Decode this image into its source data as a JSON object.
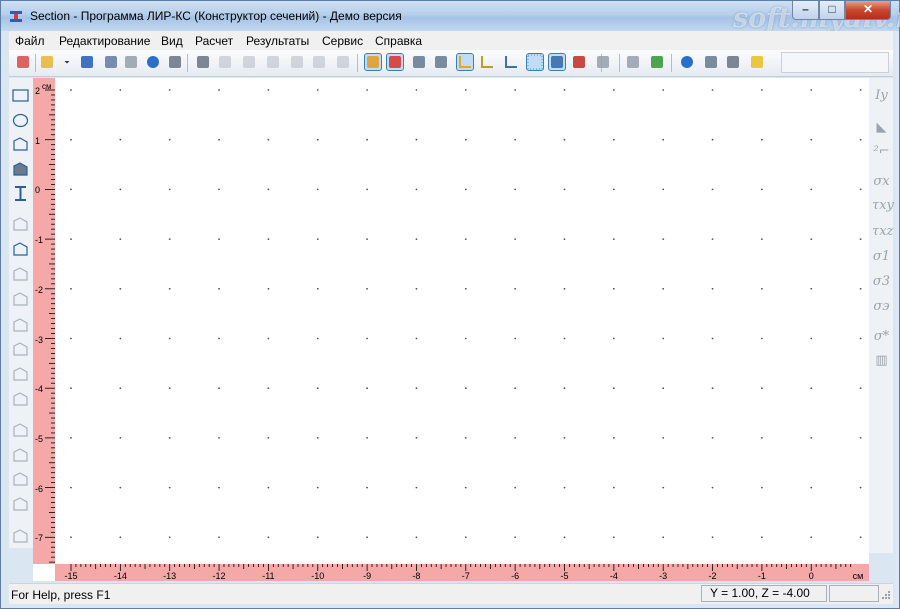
{
  "window": {
    "title": "Section - Программа ЛИР-КС (Конструктор сечений) - Демо версия",
    "watermark": "soft.mydiv.net",
    "controls": {
      "minimize": "–",
      "maximize": "□",
      "close": "✕"
    }
  },
  "menu": [
    {
      "label": "Файл"
    },
    {
      "label": "Редактирование"
    },
    {
      "label": "Вид"
    },
    {
      "label": "Расчет"
    },
    {
      "label": "Результаты"
    },
    {
      "label": "Сервис"
    },
    {
      "label": "Справка"
    }
  ],
  "toolbar": {
    "buttons": [
      {
        "icon": "new-document-icon",
        "color": "#d9534f"
      },
      {
        "icon": "open-folder-icon",
        "color": "#e9b73e"
      },
      {
        "icon": "dropdown-arrow-icon",
        "color": "#333333"
      },
      {
        "icon": "save-icon",
        "color": "#2f64b8"
      },
      {
        "icon": "save-as-icon",
        "color": "#6d7fa8"
      },
      {
        "icon": "import-icon",
        "color": "#9aa3ad"
      },
      {
        "icon": "info-icon",
        "color": "#2b6ec9"
      },
      {
        "icon": "print-icon",
        "color": "#707a86"
      },
      {
        "icon": "print-preview-icon",
        "color": "#707a86"
      },
      {
        "icon": "undo-icon",
        "color": "#b9c0c8"
      },
      {
        "icon": "redo-icon",
        "color": "#b9c0c8"
      },
      {
        "icon": "cut-icon",
        "color": "#b9c0c8"
      },
      {
        "icon": "copy-icon",
        "color": "#b9c0c8"
      },
      {
        "icon": "paste-icon",
        "color": "#b9c0c8"
      },
      {
        "icon": "delete-icon",
        "color": "#b9c0c8"
      },
      {
        "icon": "section-fill-icon",
        "color": "#e0a030",
        "active": true
      },
      {
        "icon": "color-fill-icon",
        "color": "#d93a3a",
        "active": true
      },
      {
        "icon": "zoom-icon",
        "color": "#6d7f95"
      },
      {
        "icon": "zoom-fit-icon",
        "color": "#6d7f95"
      },
      {
        "icon": "axes-box-icon",
        "color": "#e8a628",
        "active": true
      },
      {
        "icon": "axes-icon",
        "color": "#c29b2e"
      },
      {
        "icon": "axes-arrows-icon",
        "color": "#3f6fb0"
      },
      {
        "icon": "grid-icon",
        "color": "#4a90d9",
        "active": true
      },
      {
        "icon": "select-pointer-icon",
        "color": "#3a6ea8",
        "active": true
      },
      {
        "icon": "move-tool-icon",
        "color": "#c0392b"
      },
      {
        "icon": "layer-icon",
        "color": "#9aa3ad"
      },
      {
        "icon": "binoculars-icon",
        "color": "#9aa3ad"
      },
      {
        "icon": "flip-icon",
        "color": "#3c9a3c"
      },
      {
        "icon": "help-icon",
        "color": "#2b6ec9"
      },
      {
        "icon": "context-help-icon",
        "color": "#6d7f95"
      },
      {
        "icon": "about-icon",
        "color": "#707a86"
      },
      {
        "icon": "question-icon",
        "color": "#e8c22a"
      }
    ]
  },
  "left_tools": [
    {
      "icon": "rectangle-tool-icon",
      "enabled": true
    },
    {
      "icon": "ellipse-tool-icon",
      "enabled": true
    },
    {
      "icon": "polygon-tool-icon",
      "enabled": true
    },
    {
      "icon": "pin-tool-icon",
      "enabled": true
    },
    {
      "icon": "i-beam-tool-icon",
      "enabled": true
    },
    {
      "icon": "angle-profile-icon",
      "enabled": false
    },
    {
      "icon": "axes-origin-icon",
      "enabled": true
    },
    {
      "icon": "mirror-icon",
      "enabled": false
    },
    {
      "icon": "rotate-icon",
      "enabled": false
    },
    {
      "icon": "points-icon",
      "enabled": false
    },
    {
      "icon": "select-area-icon",
      "enabled": false
    },
    {
      "icon": "line-tool-icon",
      "enabled": false
    },
    {
      "icon": "dimension-icon",
      "enabled": false
    },
    {
      "icon": "copy-shape-icon",
      "enabled": false
    },
    {
      "icon": "array-icon",
      "enabled": false
    },
    {
      "icon": "union-icon",
      "enabled": false
    },
    {
      "icon": "subtract-icon",
      "enabled": false
    },
    {
      "icon": "group-icon",
      "enabled": false
    }
  ],
  "right_tools": [
    {
      "icon": "inertia-icon",
      "label": "Iy"
    },
    {
      "icon": "section-props-icon",
      "label": "◣"
    },
    {
      "icon": "section-stats-icon",
      "label": "²⌐"
    },
    {
      "icon": "sigma-x-icon",
      "label": "σx"
    },
    {
      "icon": "tau-xy-icon",
      "label": "τxy"
    },
    {
      "icon": "tau-xz-icon",
      "label": "τxz"
    },
    {
      "icon": "sigma-1-icon",
      "label": "σ1"
    },
    {
      "icon": "sigma-3-icon",
      "label": "σ3"
    },
    {
      "icon": "sigma-eq-icon",
      "label": "σэ"
    },
    {
      "icon": "sigma-result-icon",
      "label": "σ*"
    },
    {
      "icon": "diagram-icon",
      "label": "▥"
    }
  ],
  "rulers": {
    "vertical_unit": "см",
    "vertical_labels": [
      "2",
      "1",
      "0",
      "-1",
      "-2",
      "-3",
      "-4",
      "-5",
      "-6",
      "-7"
    ],
    "horizontal_labels": [
      "-15",
      "-14",
      "-13",
      "-12",
      "-11",
      "-10",
      "-9",
      "-8",
      "-7",
      "-6",
      "-5",
      "-4",
      "-3",
      "-2",
      "-1",
      "0"
    ],
    "horizontal_unit": "см",
    "ruler_color": "#f5a8a8"
  },
  "status": {
    "help": "For Help, press F1",
    "coords": "Y = 1.00, Z = -4.00"
  }
}
